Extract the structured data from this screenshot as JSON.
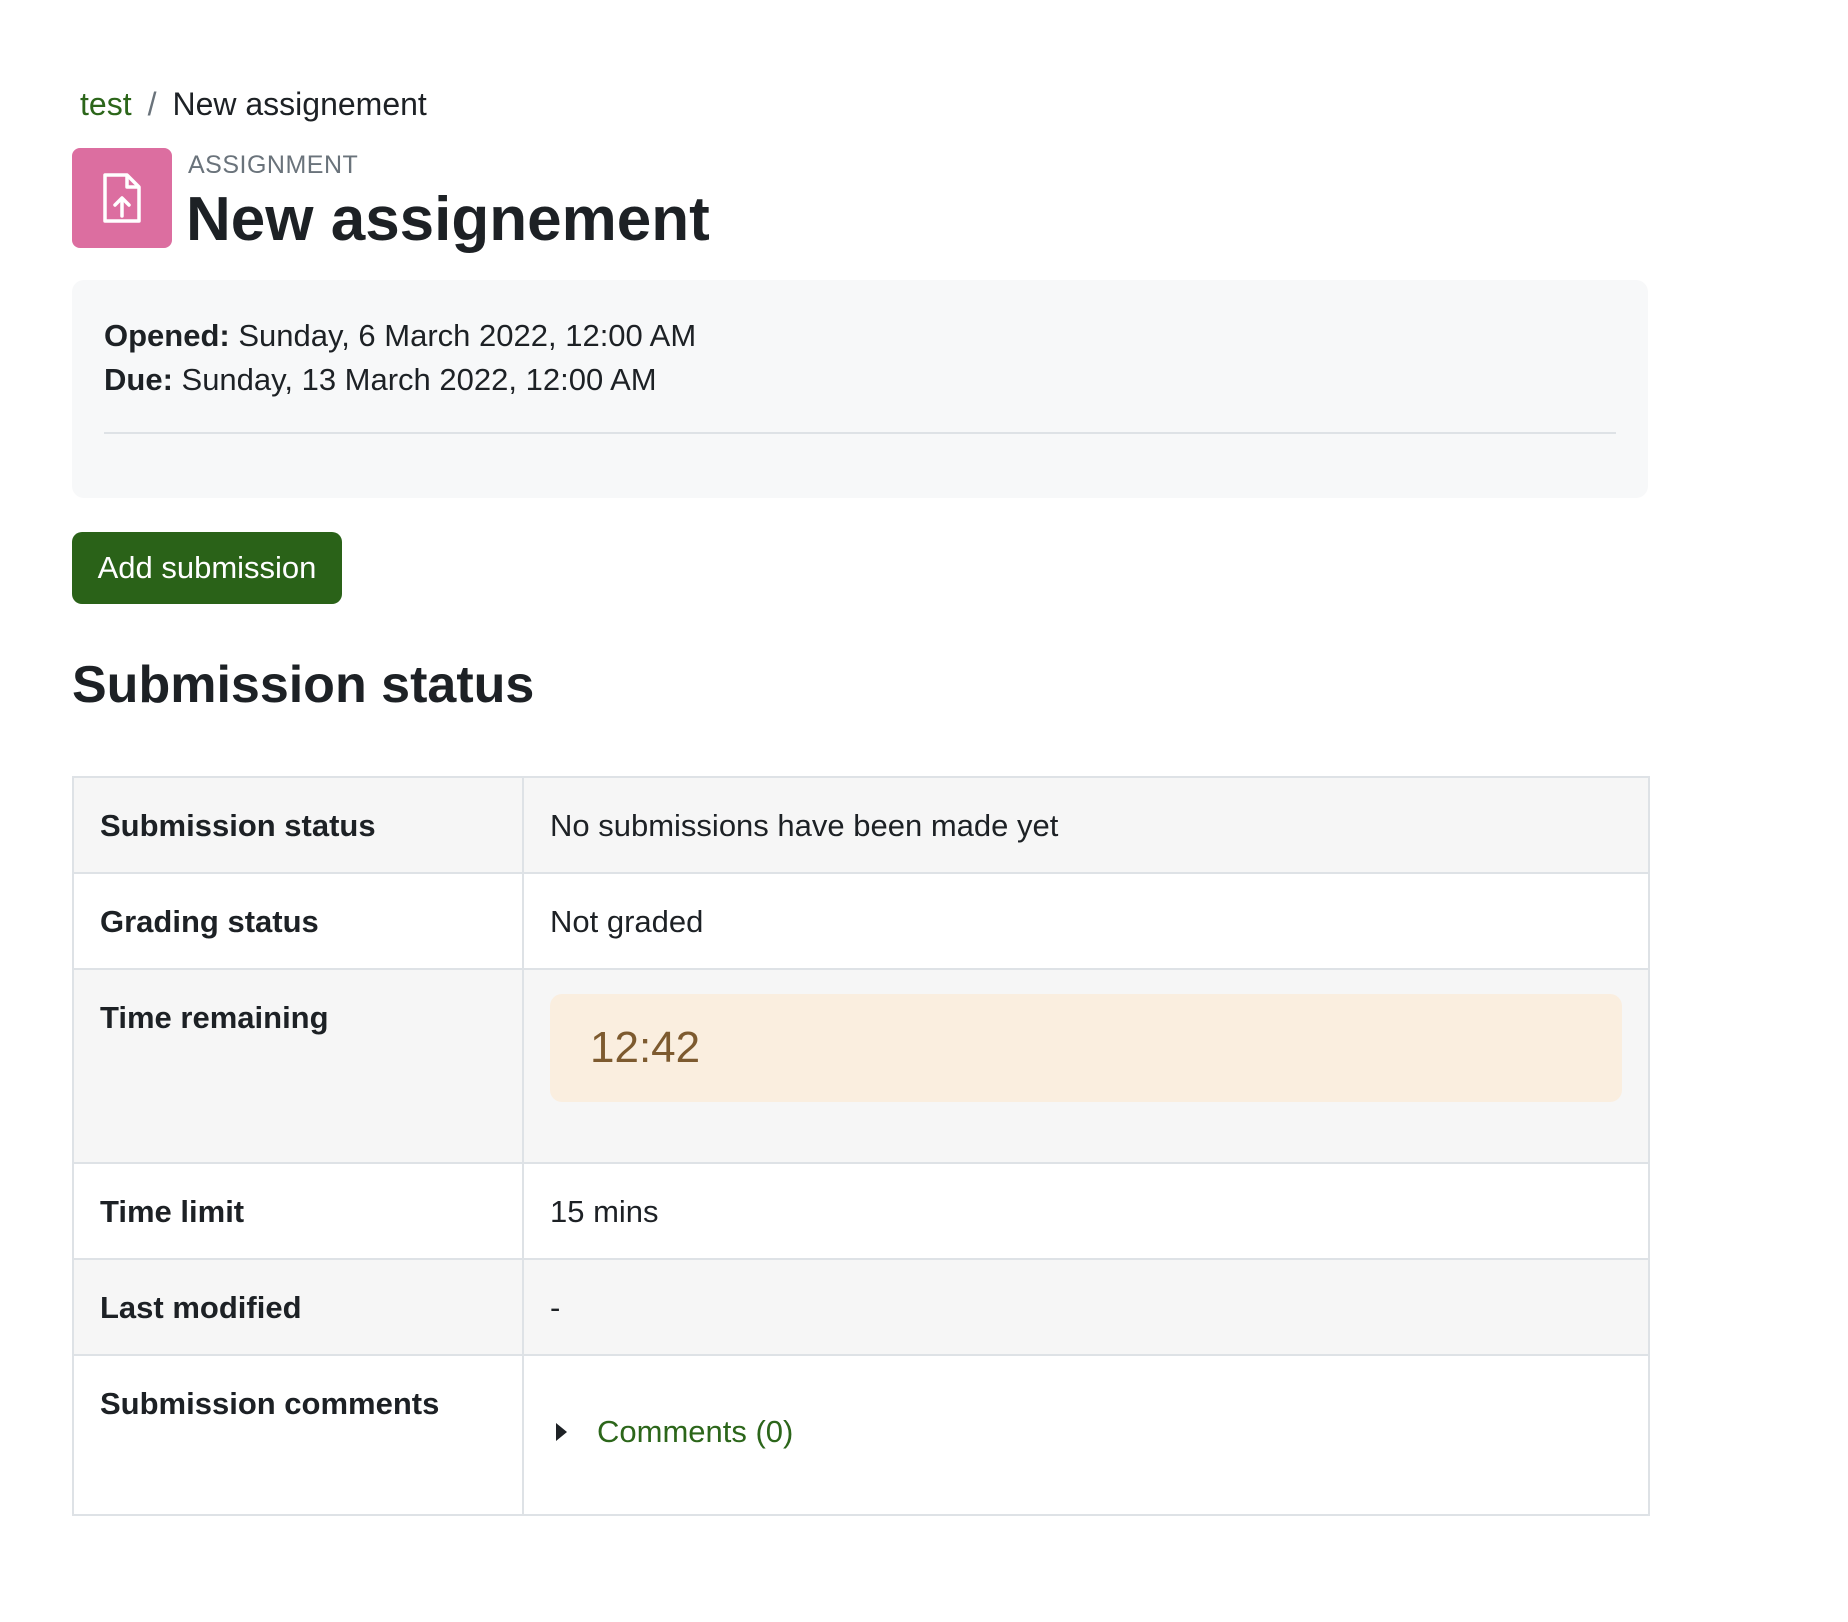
{
  "breadcrumb": {
    "course": "test",
    "separator": "/",
    "current": "New assignement"
  },
  "header": {
    "activity_type": "ASSIGNMENT",
    "title": "New assignement",
    "icon": "file-upload-icon",
    "icon_bg": "#dc6ea0"
  },
  "dates": {
    "opened_label": "Opened:",
    "opened_value": "Sunday, 6 March 2022, 12:00 AM",
    "due_label": "Due:",
    "due_value": "Sunday, 13 March 2022, 12:00 AM"
  },
  "actions": {
    "add_submission": "Add submission",
    "button_color": "#2a6218"
  },
  "submission": {
    "heading": "Submission status",
    "rows": [
      {
        "label": "Submission status",
        "value": "No submissions have been made yet"
      },
      {
        "label": "Grading status",
        "value": "Not graded"
      },
      {
        "label": "Time remaining",
        "value": "12:42"
      },
      {
        "label": "Time limit",
        "value": "15 mins"
      },
      {
        "label": "Last modified",
        "value": "-"
      },
      {
        "label": "Submission comments",
        "value": "Comments (0)"
      }
    ]
  },
  "colors": {
    "link": "#2c661a",
    "timer_bg": "#faeedf",
    "timer_text": "#7d5a2f"
  }
}
